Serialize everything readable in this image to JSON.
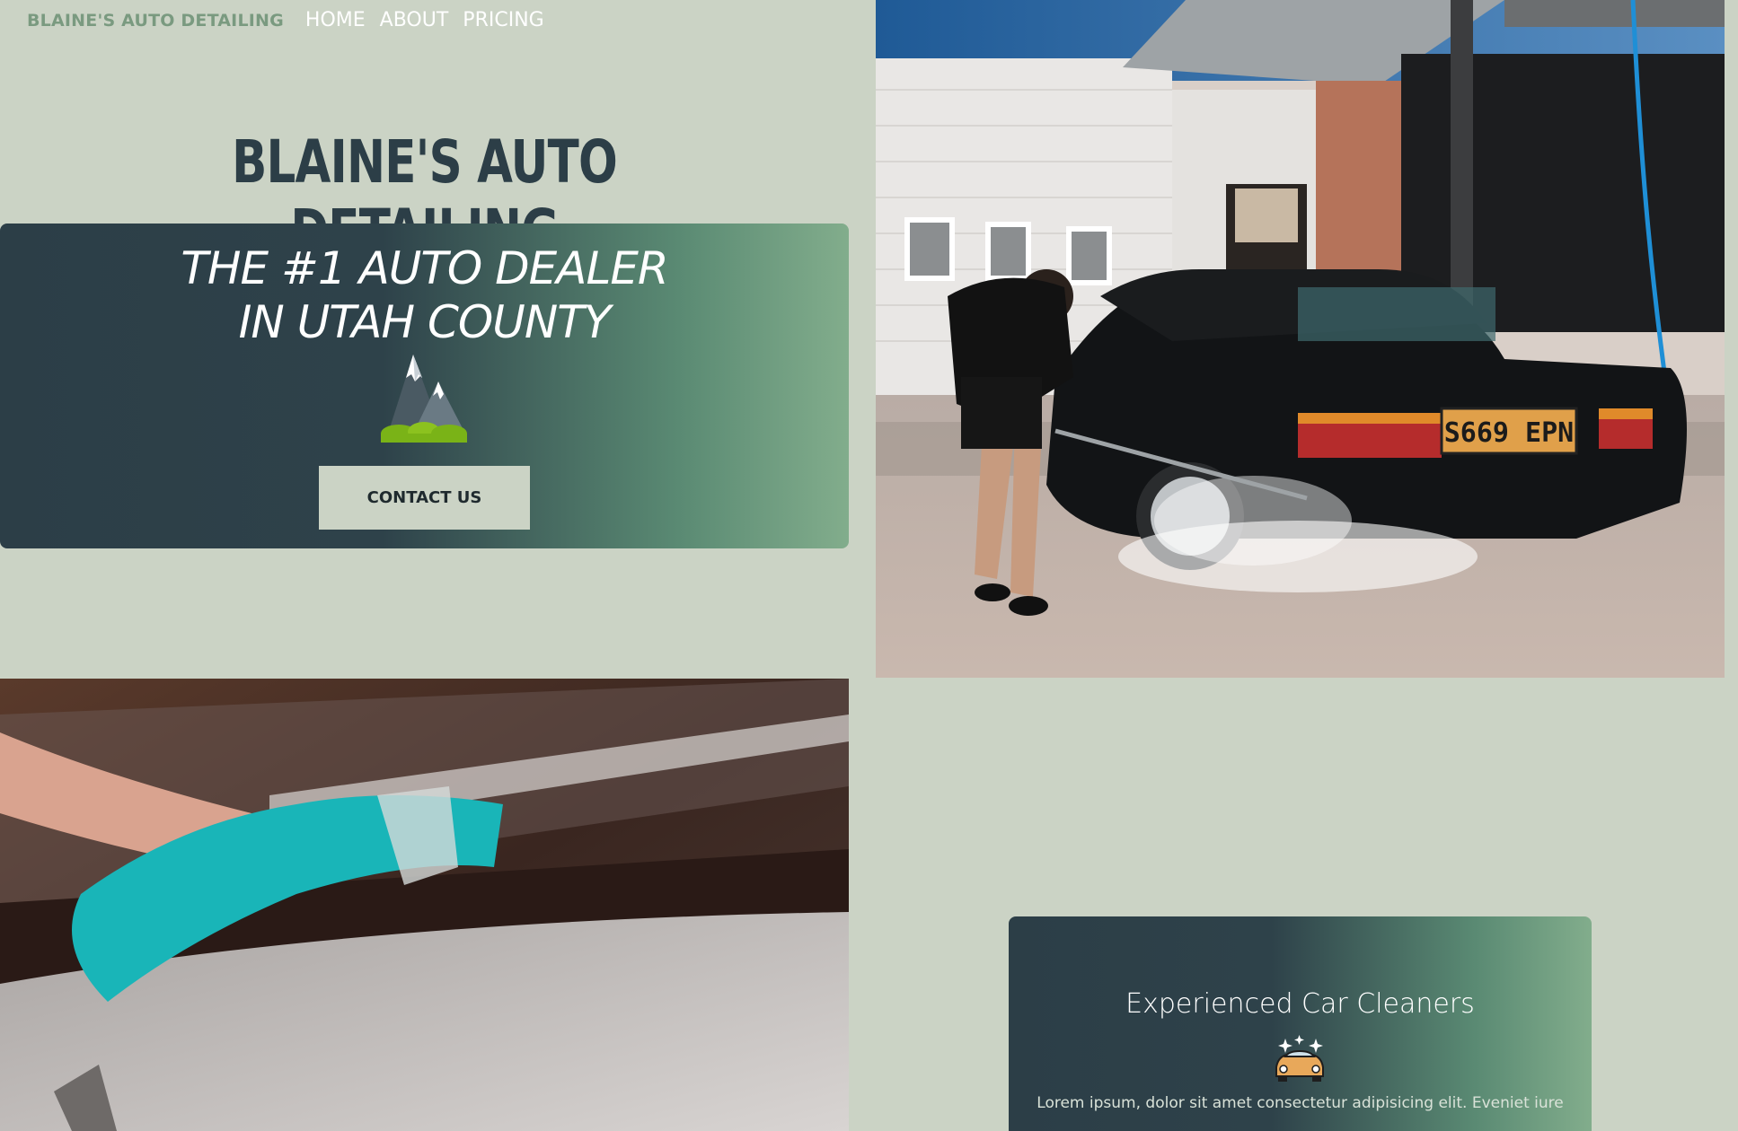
{
  "nav": {
    "brand": "BLAINE'S AUTO DETAILING",
    "links": [
      "HOME",
      "ABOUT",
      "PRICING"
    ]
  },
  "hero": {
    "title": "BLAINE'S AUTO DETAILING",
    "tagline_line1": "THE #1 AUTO DEALER",
    "tagline_line2": "IN UTAH COUNTY",
    "icon": "mountain-icon",
    "button_label": "CONTACT US"
  },
  "photos": {
    "wash_plate": "S669 EPN"
  },
  "feature": {
    "title": "Experienced Car Cleaners",
    "icon": "sparkling-car-icon",
    "text": "Lorem ipsum, dolor sit amet consectetur adipisicing elit. Eveniet iure"
  },
  "colors": {
    "background": "#cbd3c5",
    "dark": "#2c3e47",
    "accent_green": "#82ad8c",
    "brand": "#7a9a80"
  }
}
